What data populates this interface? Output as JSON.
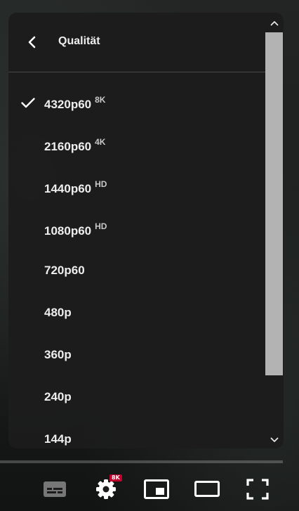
{
  "menu": {
    "title": "Qualität",
    "items": [
      {
        "label": "4320p60",
        "badge": "8K",
        "selected": true
      },
      {
        "label": "2160p60",
        "badge": "4K",
        "selected": false
      },
      {
        "label": "1440p60",
        "badge": "HD",
        "selected": false
      },
      {
        "label": "1080p60",
        "badge": "HD",
        "selected": false
      },
      {
        "label": "720p60",
        "badge": "",
        "selected": false
      },
      {
        "label": "480p",
        "badge": "",
        "selected": false
      },
      {
        "label": "360p",
        "badge": "",
        "selected": false
      },
      {
        "label": "240p",
        "badge": "",
        "selected": false
      },
      {
        "label": "144p",
        "badge": "",
        "selected": false
      }
    ]
  },
  "controls": {
    "settings_badge": "8K",
    "icons": [
      "subtitles-icon",
      "settings-gear-icon",
      "miniplayer-icon",
      "theater-mode-icon",
      "fullscreen-icon"
    ]
  },
  "colors": {
    "panel_bg": "#1c1c1c",
    "text": "#eeeeee",
    "badge_text": "#c9c9c9",
    "settings_badge_bg": "#c0002a",
    "scroll_thumb": "#b3b3b3"
  }
}
